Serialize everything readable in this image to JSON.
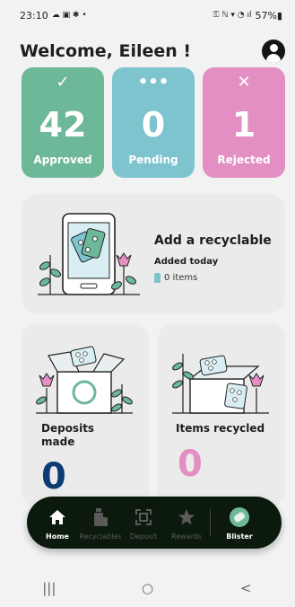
{
  "status_bar": {
    "time": "23:10",
    "left_icons": "☁ ▣ ✱ •",
    "right_icons": "⚿ ℕ ▾ ◔ ıl",
    "battery": "57%▮"
  },
  "header": {
    "title": "Welcome, Eileen !"
  },
  "stats": {
    "approved": {
      "icon": "✓",
      "value": "42",
      "label": "Approved",
      "color": "#6eb89a"
    },
    "pending": {
      "icon": "•••",
      "value": "0",
      "label": "Pending",
      "color": "#7ec4cf"
    },
    "rejected": {
      "icon": "✕",
      "value": "1",
      "label": "Rejected",
      "color": "#e38fc3"
    }
  },
  "add_card": {
    "title": "Add a recyclable",
    "subtitle": "Added today",
    "items": "0 items"
  },
  "deposits": {
    "label": "Deposits made",
    "value": "0"
  },
  "recycled": {
    "label": "Items recycled",
    "value": "0"
  },
  "nav": {
    "home": "Home",
    "recyclables": "Recyclables",
    "deposit": "Deposit",
    "rewards": "Rewards",
    "blister": "Blister"
  },
  "system_nav": {
    "recents": "|||",
    "home": "○",
    "back": "<"
  }
}
